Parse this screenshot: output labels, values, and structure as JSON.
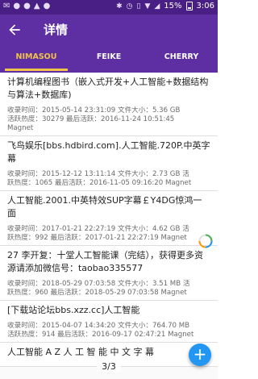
{
  "status_bar": {
    "battery": "15%",
    "time": "3:06",
    "left_icons": [
      "notification-a",
      "notification-b",
      "notification-c",
      "notification-d",
      "notification-e"
    ],
    "right_icons": [
      "bluetooth-icon",
      "alarm-icon",
      "vibrate-icon",
      "wifi-icon",
      "signal-icon"
    ]
  },
  "app_bar": {
    "title": "详情",
    "back_icon": "arrow-left-icon"
  },
  "tabs": [
    {
      "label": "NIMASOU",
      "active": true
    },
    {
      "label": "FEIKE",
      "active": false
    },
    {
      "label": "CHERRY",
      "active": false
    }
  ],
  "items": [
    {
      "title": "计算机编程图书（嵌入式开发+人工智能+数据结构与算法+数据库)",
      "line1": "收录时间：2015-05-14 23:31:09 文件大小：5.36 GB",
      "line2": "活跃热度：30279 最后活跃：2016-11-24 10:51:45",
      "line3": "Magnet"
    },
    {
      "title": "飞鸟娱乐[bbs.hdbird.com].人工智能.720P.中英字幕",
      "line1": "收录时间：2015-12-12 13:11:14 文件大小：2.73 GB 活",
      "line2": "跃热度：1065 最后活跃：2016-11-05 09:16:20 Magnet",
      "line3": ""
    },
    {
      "title": "人工智能.2001.中英特效SUP字幕￡Y4DG惊鸿一面",
      "line1": "收录时间：2017-01-21 22:27:19 文件大小：4.62 GB 活",
      "line2": "跃热度：992 最后活跃：2017-01-21 22:27:19 Magnet",
      "line3": ""
    },
    {
      "title": "27 李开复：十堂人工智能课（完结），获得更多资源请添加微信号：taobao335577",
      "line1": "收录时间：2018-05-29 07:03:58 文件大小：3.51 MB 活",
      "line2": "跃热度：960 最后活跃：2018-05-29 07:03:58 Magnet",
      "line3": ""
    },
    {
      "title": "[下载站论坛bbs.xzz.cc]人工智能",
      "line1": "收录时间：2015-04-07 14:34:20 文件大小：764.70 MB",
      "line2": "活跃热度：914 最后活跃：2016-09-17 02:47:21 Magnet",
      "line3": ""
    },
    {
      "title": "人工智能 A Z 人 工 智 能 中 文 字 幕",
      "line1": "",
      "line2": "",
      "line3": ""
    }
  ],
  "page_indicator": "3/3",
  "fab_label": "+"
}
